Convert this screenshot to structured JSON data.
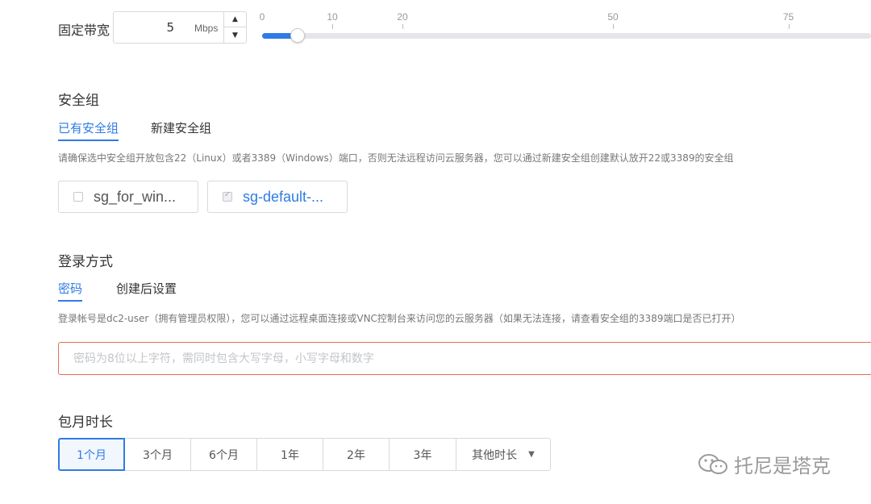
{
  "bandwidth": {
    "label": "固定带宽",
    "value": "5",
    "unit": "Mbps",
    "ticks": [
      "0",
      "10",
      "20",
      "50",
      "75"
    ],
    "slider_value": 5,
    "slider_min": 0,
    "slider_max": 100
  },
  "security_group": {
    "title": "安全组",
    "tabs": [
      {
        "label": "已有安全组",
        "active": true
      },
      {
        "label": "新建安全组",
        "active": false
      }
    ],
    "hint": "请确保选中安全组开放包含22（Linux）或者3389（Windows）端口，否则无法远程访问云服务器，您可以通过新建安全组创建默认放开22或3389的安全组",
    "groups": [
      {
        "name": "sg_for_win...",
        "checked": false
      },
      {
        "name": "sg-default-...",
        "checked": true
      }
    ]
  },
  "login": {
    "title": "登录方式",
    "tabs": [
      {
        "label": "密码",
        "active": true
      },
      {
        "label": "创建后设置",
        "active": false
      }
    ],
    "hint": "登录帐号是dc2-user（拥有管理员权限），您可以通过远程桌面连接或VNC控制台来访问您的云服务器（如果无法连接，请查看安全组的3389端口是否已打开）",
    "password_placeholder": "密码为8位以上字符，需同时包含大写字母，小写字母和数字",
    "password_value": ""
  },
  "duration": {
    "title": "包月时长",
    "options": [
      "1个月",
      "3个月",
      "6个月",
      "1年",
      "2年",
      "3年"
    ],
    "selected": "1个月",
    "other_label": "其他时长"
  },
  "watermark": {
    "text": "托尼是塔克",
    "icon": "wechat-icon"
  },
  "colors": {
    "accent": "#2f7be5",
    "error_border": "#e96a55"
  }
}
